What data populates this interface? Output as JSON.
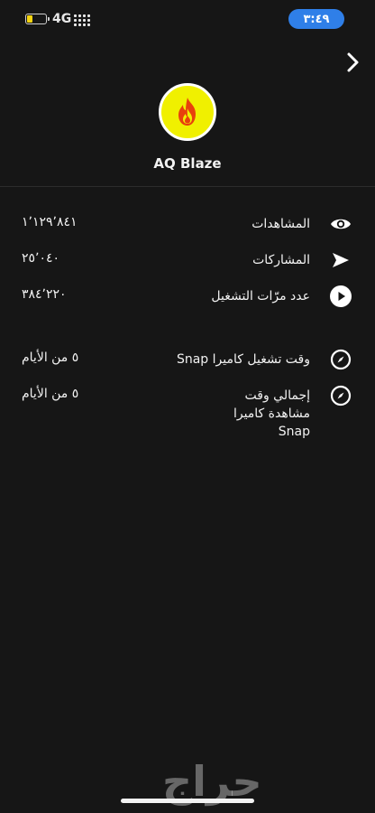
{
  "status_bar": {
    "network": "4G",
    "time": "٣:٤٩",
    "battery_color": "#f5d40f"
  },
  "profile": {
    "name": "AQ Blaze",
    "avatar_bg": "#f0f000",
    "avatar_icon": "fire-icon"
  },
  "stats": [
    {
      "label": "المشاهدات",
      "value": "١٬١٢٩٬٨٤١",
      "icon": "eye-icon"
    },
    {
      "label": "المشاركات",
      "value": "٢٥٬٠٤٠",
      "icon": "send-arrow-icon"
    },
    {
      "label": "عدد مرّات التشغيل",
      "value": "٣٨٤٬٢٢٠",
      "icon": "play-icon"
    }
  ],
  "camera_stats": [
    {
      "label": "وقت تشغيل كاميرا Snap",
      "value": "٥ من الأيام",
      "icon": "compass-icon"
    },
    {
      "label": "إجمالي وقت مشاهدة كاميرا Snap",
      "value": "٥ من الأيام",
      "icon": "compass-icon"
    }
  ],
  "watermark": "حراج"
}
